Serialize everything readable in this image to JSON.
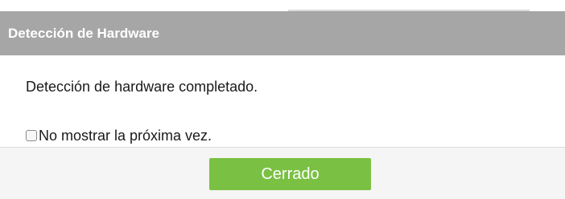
{
  "dialog": {
    "title": "Detección de Hardware",
    "message": "Detección de hardware completado.",
    "checkbox_label": "No mostrar la próxima vez.",
    "checkbox_checked": false,
    "close_button_label": "Cerrado"
  },
  "colors": {
    "titlebar_bg": "#a6a6a6",
    "button_bg": "#7ac143",
    "footer_bg": "#f5f5f5"
  }
}
